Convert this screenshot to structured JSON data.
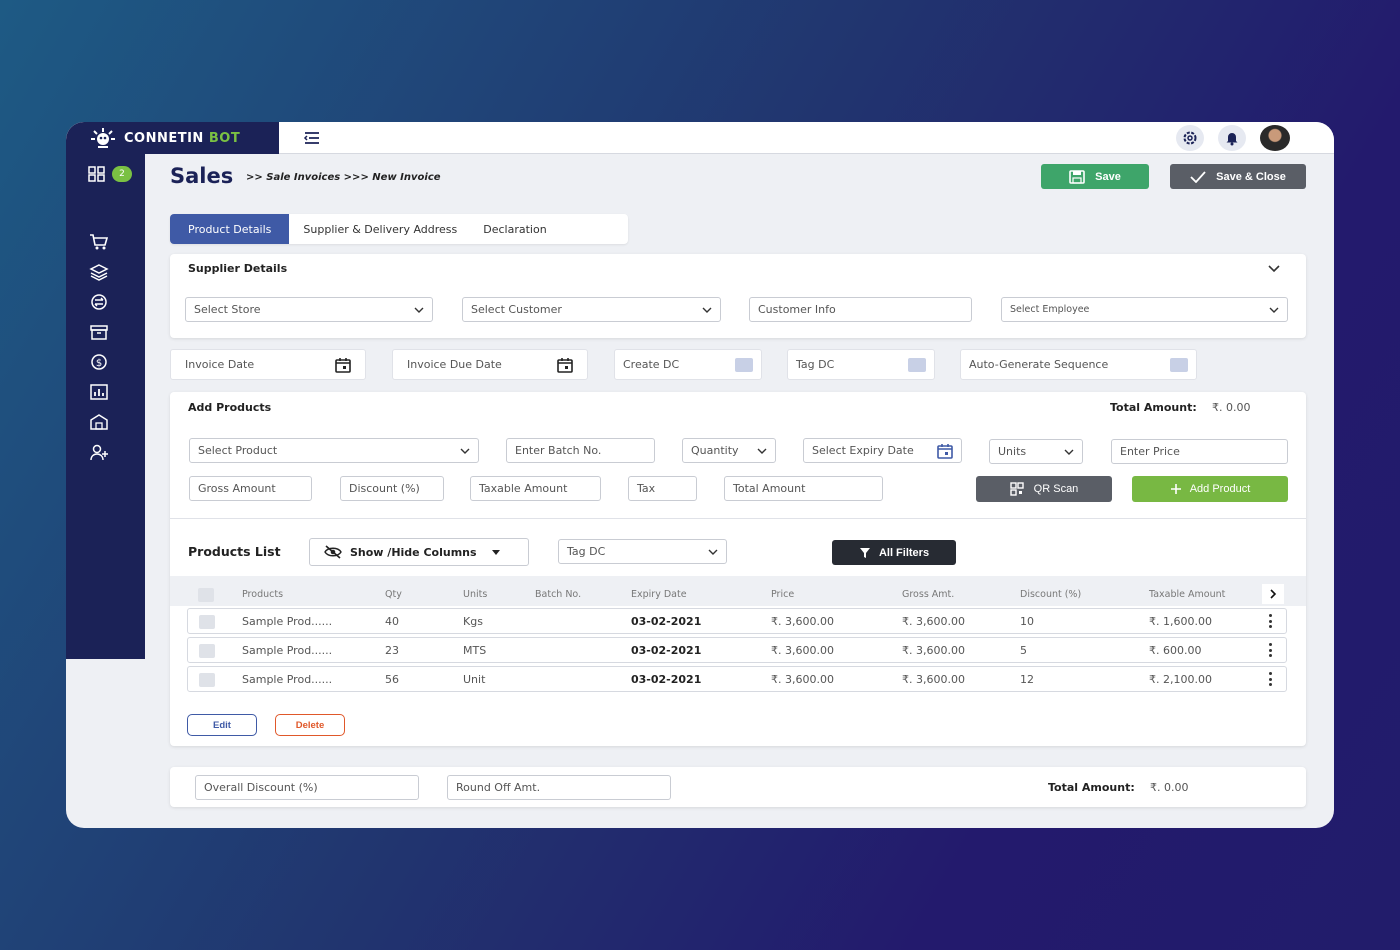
{
  "brand": {
    "name_main": "CONNETIN",
    "name_accent": "BOT"
  },
  "sidebar": {
    "dashboard_badge": "2"
  },
  "header": {
    "title": "Sales",
    "breadcrumb": ">> Sale Invoices >>> New Invoice",
    "save_label": "Save",
    "save_close_label": "Save & Close"
  },
  "tabs": [
    {
      "label": "Product Details",
      "active": true
    },
    {
      "label": "Supplier & Delivery Address"
    },
    {
      "label": "Declaration"
    }
  ],
  "supplier": {
    "title": "Supplier Details",
    "store_placeholder": "Select  Store",
    "customer_placeholder": "Select  Customer",
    "customer_info_placeholder": "Customer Info",
    "employee_placeholder": "Select  Employee"
  },
  "invoice": {
    "invoice_date": "Invoice Date",
    "due_date": "Invoice Due Date",
    "create_dc": "Create DC",
    "tag_dc": "Tag DC",
    "auto_sequence": "Auto-Generate Sequence"
  },
  "add_products": {
    "title": "Add Products",
    "total_label": "Total Amount:",
    "total_value": "₹. 0.00",
    "product_placeholder": "Select Product",
    "batch_placeholder": "Enter Batch No.",
    "quantity_placeholder": "Quantity",
    "expiry_placeholder": "Select Expiry Date",
    "units_placeholder": "Units",
    "price_placeholder": "Enter Price",
    "gross_placeholder": "Gross Amount",
    "discount_placeholder": "Discount (%)",
    "taxable_placeholder": "Taxable Amount",
    "tax_placeholder": "Tax",
    "total_placeholder": "Total Amount",
    "qr_label": "QR Scan",
    "add_label": "Add Product"
  },
  "products_list": {
    "title": "Products List",
    "show_hide_label": "Show /Hide Columns",
    "tag_dc_placeholder": "Tag DC",
    "filters_label": "All Filters",
    "columns": [
      "Products",
      "Qty",
      "Units",
      "Batch No.",
      "Expiry Date",
      "Price",
      "Gross Amt.",
      "Discount (%)",
      "Taxable Amount"
    ],
    "rows": [
      {
        "product": "Sample Prod......",
        "qty": "40",
        "units": "Kgs",
        "batch": "",
        "expiry": "03-02-2021",
        "price": "₹. 3,600.00",
        "gross": "₹. 3,600.00",
        "discount": "10",
        "taxable": "₹. 1,600.00"
      },
      {
        "product": "Sample Prod......",
        "qty": "23",
        "units": "MTS",
        "batch": "",
        "expiry": "03-02-2021",
        "price": "₹. 3,600.00",
        "gross": "₹. 3,600.00",
        "discount": "5",
        "taxable": "₹. 600.00"
      },
      {
        "product": "Sample Prod......",
        "qty": "56",
        "units": "Unit",
        "batch": "",
        "expiry": "03-02-2021",
        "price": "₹. 3,600.00",
        "gross": "₹. 3,600.00",
        "discount": "12",
        "taxable": "₹. 2,100.00"
      }
    ],
    "edit_label": "Edit",
    "delete_label": "Delete"
  },
  "footer": {
    "overall_discount_placeholder": "Overall Discount (%)",
    "round_off_placeholder": "Round Off Amt.",
    "total_label": "Total Amount:",
    "total_value": "₹. 0.00"
  },
  "colors": {
    "sidebar": "#1b2257",
    "primary": "#3f5aa6",
    "save": "#3ea56a",
    "add": "#78b843",
    "delete": "#e0582a"
  }
}
